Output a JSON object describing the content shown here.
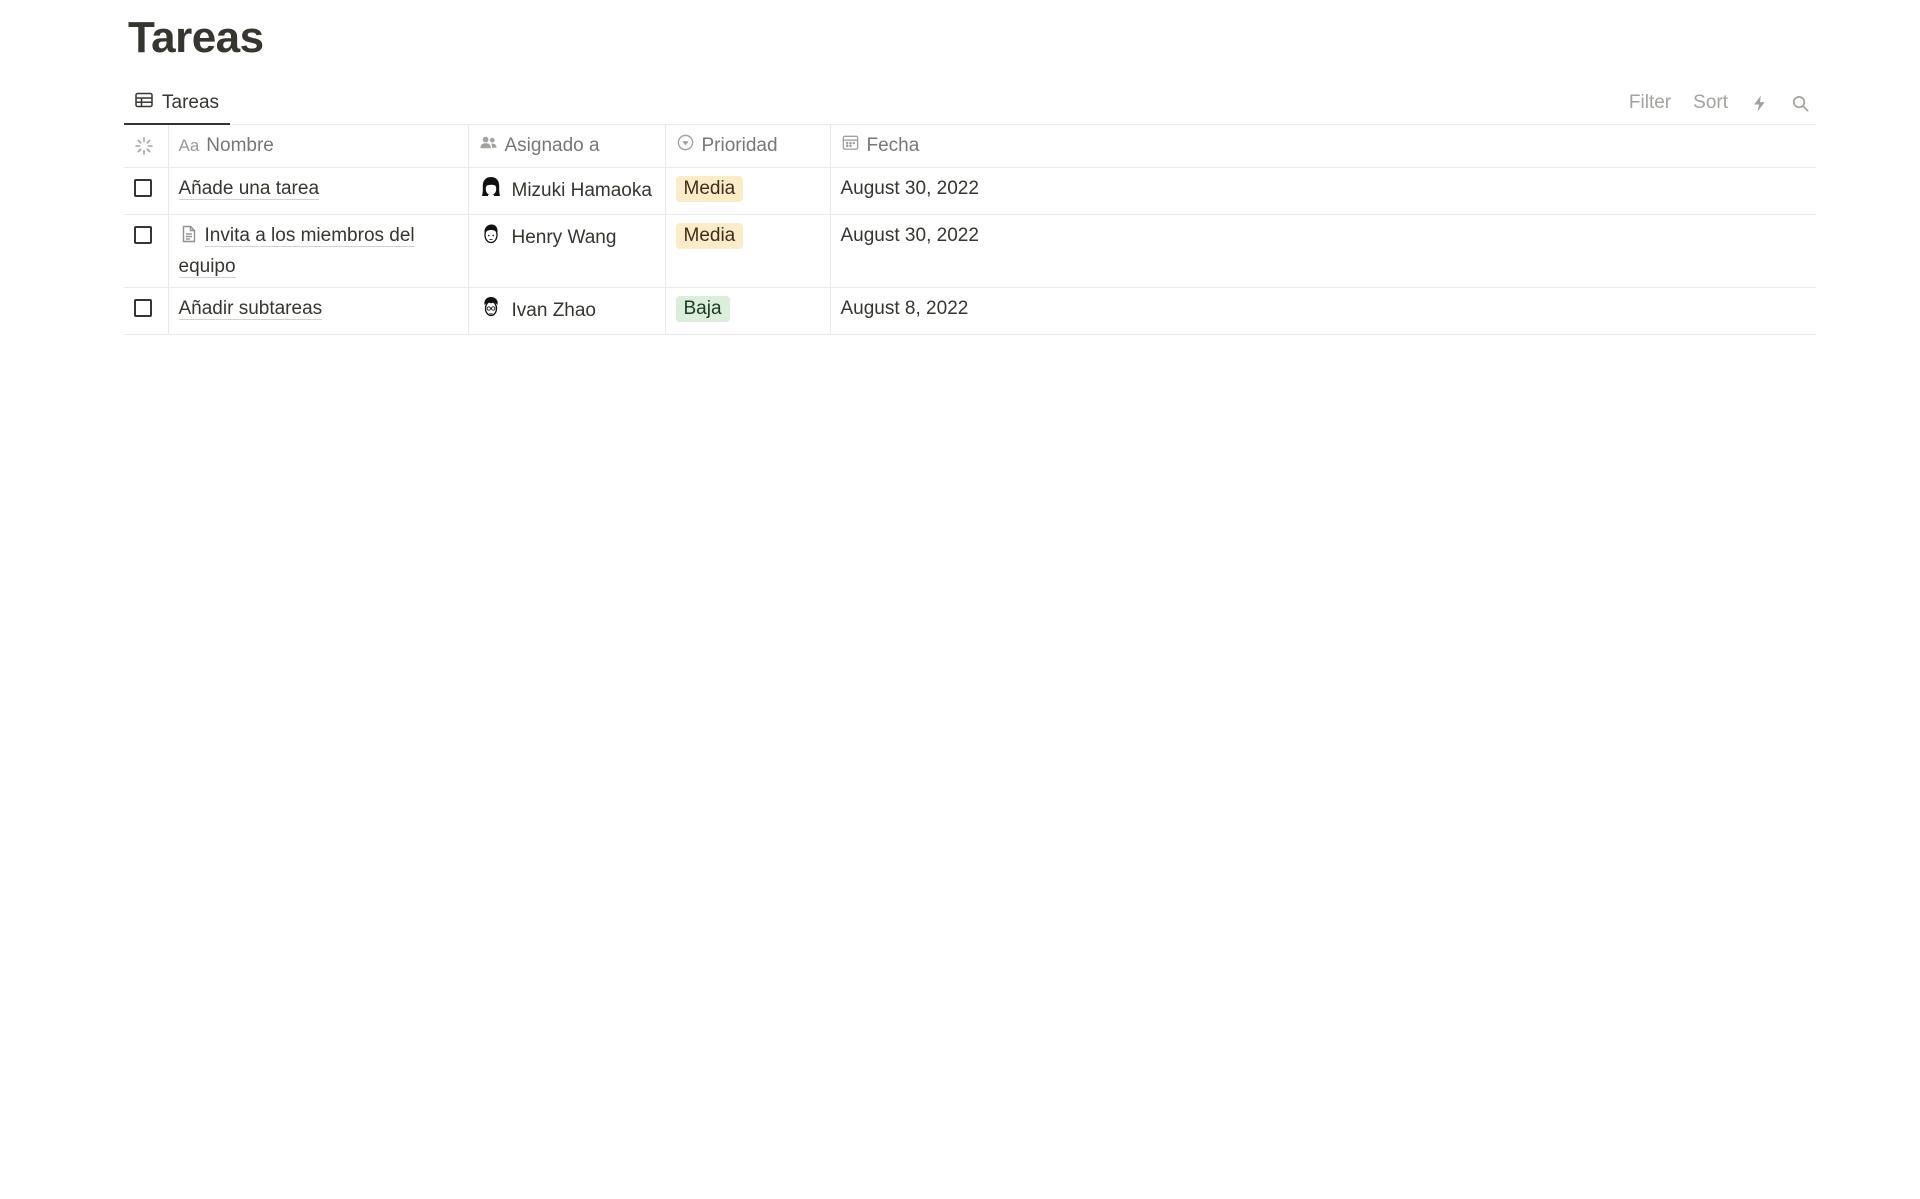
{
  "page": {
    "title": "Tareas"
  },
  "view": {
    "tab_label": "Tareas",
    "tab_icon": "table-icon"
  },
  "tools": {
    "filter": "Filter",
    "sort": "Sort",
    "automation_icon": "lightning-icon",
    "search_icon": "search-icon"
  },
  "columns": {
    "done": {
      "icon": "status-loading-icon"
    },
    "name": {
      "prefix": "Aa",
      "label": "Nombre"
    },
    "assignee": {
      "icon": "people-icon",
      "label": "Asignado a"
    },
    "priority": {
      "icon": "select-icon",
      "label": "Prioridad"
    },
    "date": {
      "icon": "calendar-icon",
      "label": "Fecha"
    }
  },
  "rows": [
    {
      "done": false,
      "name": "Añade una tarea",
      "has_doc": false,
      "assignee": "Mizuki Hamaoka",
      "priority": "Media",
      "date": "August 30, 2022"
    },
    {
      "done": false,
      "name": "Invita a los miembros del equipo",
      "has_doc": true,
      "assignee": "Henry Wang",
      "priority": "Media",
      "date": "August 30, 2022"
    },
    {
      "done": false,
      "name": "Añadir subtareas",
      "has_doc": false,
      "assignee": "Ivan Zhao",
      "priority": "Baja",
      "date": "August 8, 2022"
    }
  ],
  "colors": {
    "text": "#37352f",
    "muted": "#787774",
    "media_bg": "#fbecc9",
    "baja_bg": "#dbeddb"
  }
}
